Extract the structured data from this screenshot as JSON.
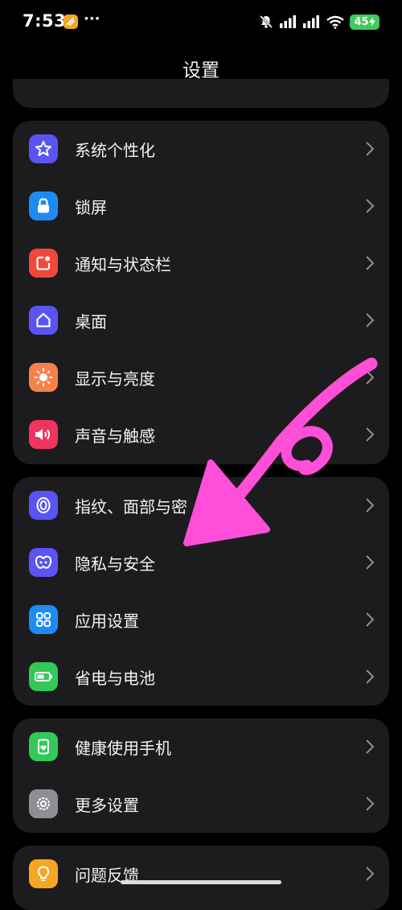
{
  "status_bar": {
    "time": "7:53",
    "battery": "45",
    "dots": "···",
    "icons": [
      "app-notification-icon",
      "mute-icon",
      "signal-icon",
      "signal-icon",
      "wifi-icon",
      "battery-icon"
    ]
  },
  "header": {
    "title": "设置"
  },
  "groups": [
    {
      "items": [
        {
          "label": "系统个性化",
          "icon": "star-icon",
          "color": "#5b53f4"
        },
        {
          "label": "锁屏",
          "icon": "lock-icon",
          "color": "#1e8bf3"
        },
        {
          "label": "通知与状态栏",
          "icon": "notification-icon",
          "color": "#f0483a"
        },
        {
          "label": "桌面",
          "icon": "home-icon",
          "color": "#5b53f4"
        },
        {
          "label": "显示与亮度",
          "icon": "sun-icon",
          "color": "#f5824a"
        },
        {
          "label": "声音与触感",
          "icon": "speaker-icon",
          "color": "#f0345d"
        }
      ]
    },
    {
      "items": [
        {
          "label": "指纹、面部与密",
          "icon": "fingerprint-icon",
          "color": "#5b53f4"
        },
        {
          "label": "隐私与安全",
          "icon": "privacy-icon",
          "color": "#5b53f4"
        },
        {
          "label": "应用设置",
          "icon": "apps-icon",
          "color": "#1e8bf3"
        },
        {
          "label": "省电与电池",
          "icon": "battery-icon",
          "color": "#34c759"
        }
      ]
    },
    {
      "items": [
        {
          "label": "健康使用手机",
          "icon": "phone-heart-icon",
          "color": "#34c759"
        },
        {
          "label": "更多设置",
          "icon": "gear-icon",
          "color": "#8e8e93"
        }
      ]
    },
    {
      "items": [
        {
          "label": "问题反馈",
          "icon": "lightbulb-icon",
          "color": "#f5a623"
        }
      ]
    }
  ],
  "annotation": {
    "color": "#ff4fd8"
  }
}
